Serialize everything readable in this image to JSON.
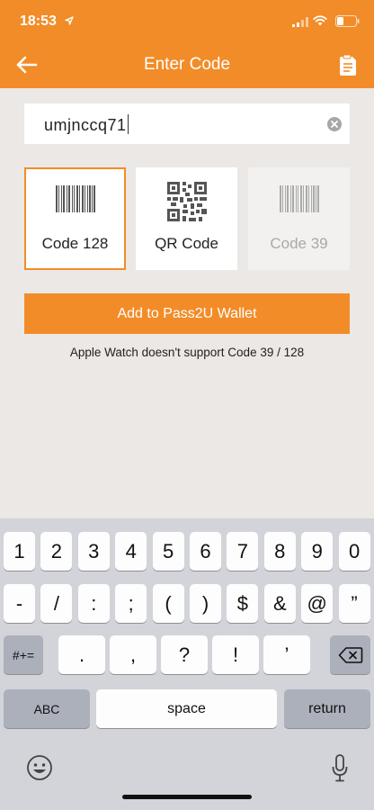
{
  "status_bar": {
    "time": "18:53"
  },
  "header": {
    "title": "Enter Code",
    "back_icon": "arrow-left-icon",
    "action_icon": "document-icon"
  },
  "code_input": {
    "value": "umjnccq71",
    "clear_icon": "clear-circle-icon"
  },
  "code_types": [
    {
      "label": "Code 128",
      "icon": "barcode-icon",
      "state": "selected"
    },
    {
      "label": "QR Code",
      "icon": "qr-code-icon",
      "state": "normal"
    },
    {
      "label": "Code 39",
      "icon": "barcode-icon",
      "state": "disabled"
    }
  ],
  "add_button": {
    "label": "Add to Pass2U Wallet"
  },
  "note": "Apple Watch doesn't support Code 39 / 128",
  "keyboard": {
    "row1": [
      "1",
      "2",
      "3",
      "4",
      "5",
      "6",
      "7",
      "8",
      "9",
      "0"
    ],
    "row2": [
      "-",
      "/",
      ":",
      ";",
      "(",
      ")",
      "$",
      "&",
      "@",
      "”"
    ],
    "row3_left": "#+=",
    "row3": [
      ".",
      ",",
      "?",
      "!",
      "’"
    ],
    "row3_right_icon": "delete-backspace-icon",
    "row4": {
      "abc": "ABC",
      "space": "space",
      "return": "return"
    },
    "emoji_icon": "emoji-icon",
    "mic_icon": "microphone-icon"
  },
  "colors": {
    "accent": "#f28c28",
    "background": "#ebe8e5",
    "keyboard": "#d2d4d9"
  }
}
